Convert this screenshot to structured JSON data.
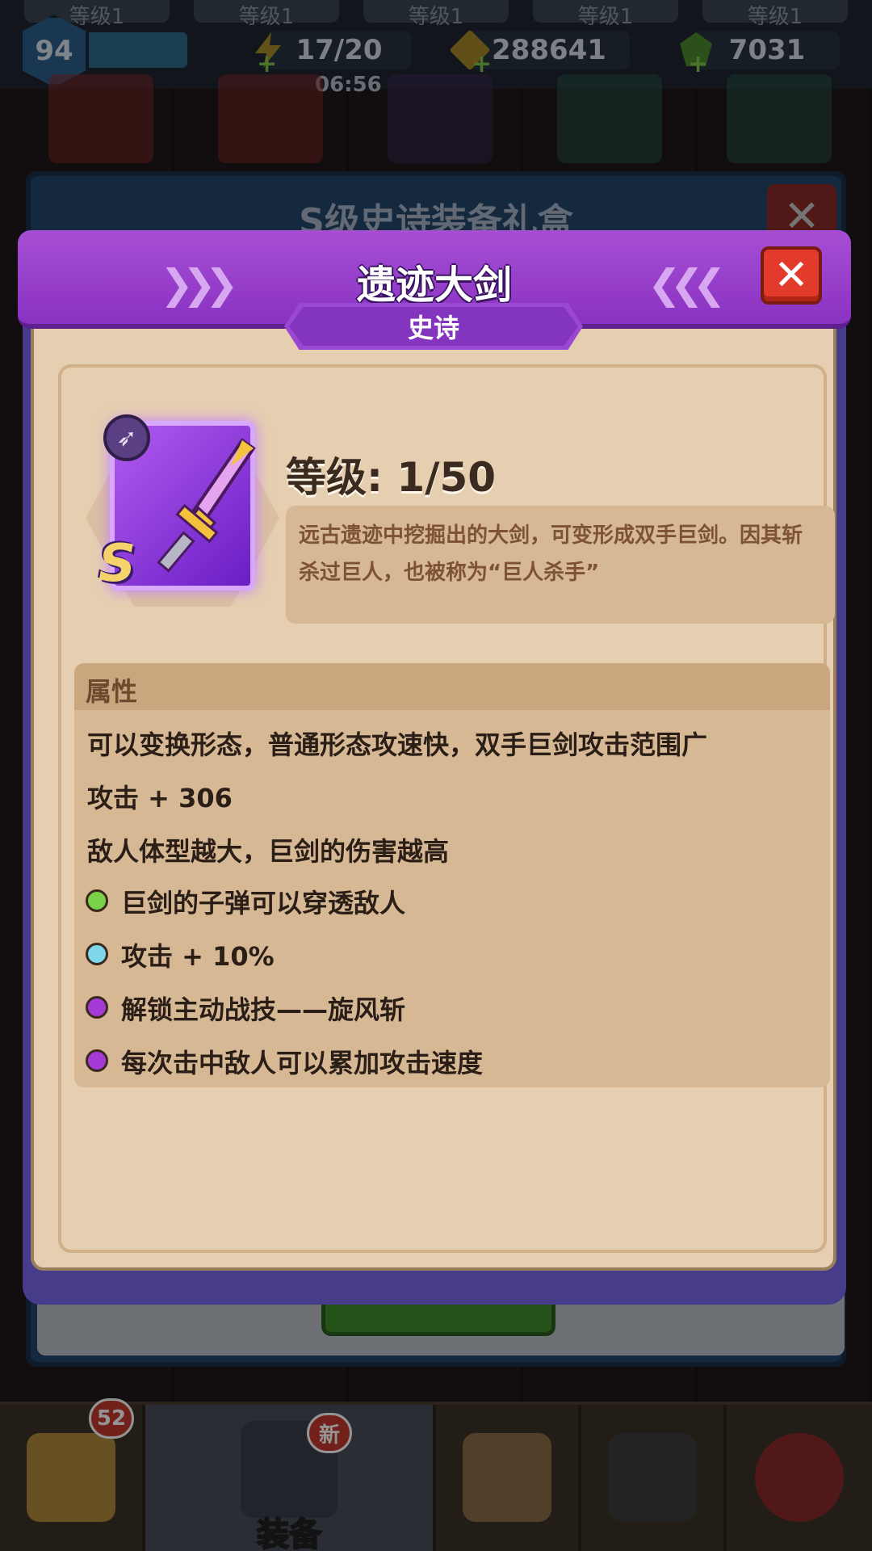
{
  "hud": {
    "top_tabs": [
      "等级1",
      "等级1",
      "等级1",
      "等级1",
      "等级1"
    ],
    "player_level": "94",
    "energy": "17/20",
    "energy_timer": "06:56",
    "gold": "288641",
    "gems": "7031",
    "plus": "+"
  },
  "back_dialog": {
    "title": "S级史诗装备礼盒",
    "close": "✕"
  },
  "item": {
    "name": "遗迹大剑",
    "rarity": "史诗",
    "grade_badge": "S",
    "level_text": "等级: 1/50",
    "description": "远古遗迹中挖掘出的大剑，可变形成双手巨剑。因其斩杀过巨人，也被称为“巨人杀手”",
    "close": "✕"
  },
  "attributes": {
    "header": "属性",
    "lines": [
      "可以变换形态，普通形态攻速快，双手巨剑攻击范围广",
      "攻击 + 306",
      "敌人体型越大，巨剑的伤害越高"
    ],
    "bullets": [
      {
        "text": "巨剑的子弹可以穿透敌人",
        "color": "#7ad14a"
      },
      {
        "text": "攻击 + 10%",
        "color": "#7fd6e8"
      },
      {
        "text": "解锁主动战技——旋风斩",
        "color": "#a33ad6"
      },
      {
        "text": "每次击中敌人可以累加攻击速度",
        "color": "#a33ad6"
      }
    ]
  },
  "bottom_nav": {
    "chest_badge": "52",
    "equip_badge": "新",
    "equip_label": "装备"
  },
  "colors": {
    "header_purple": "#9a44cf",
    "panel_bg": "#e5cfb0",
    "close_red": "#e23b2c"
  }
}
